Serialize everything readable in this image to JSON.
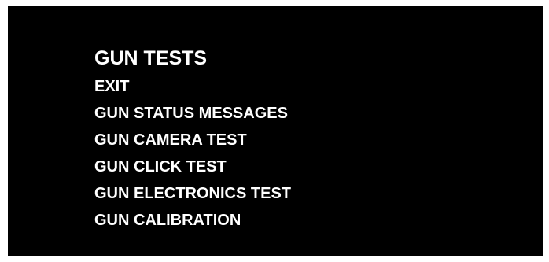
{
  "screen": {
    "background": "#000000",
    "text_color": "#ffffff"
  },
  "menu": {
    "title": "GUN TESTS",
    "items": [
      {
        "label": "EXIT"
      },
      {
        "label": "GUN STATUS MESSAGES"
      },
      {
        "label": "GUN CAMERA TEST"
      },
      {
        "label": "GUN CLICK TEST"
      },
      {
        "label": "GUN ELECTRONICS TEST"
      },
      {
        "label": "GUN CALIBRATION"
      }
    ]
  }
}
